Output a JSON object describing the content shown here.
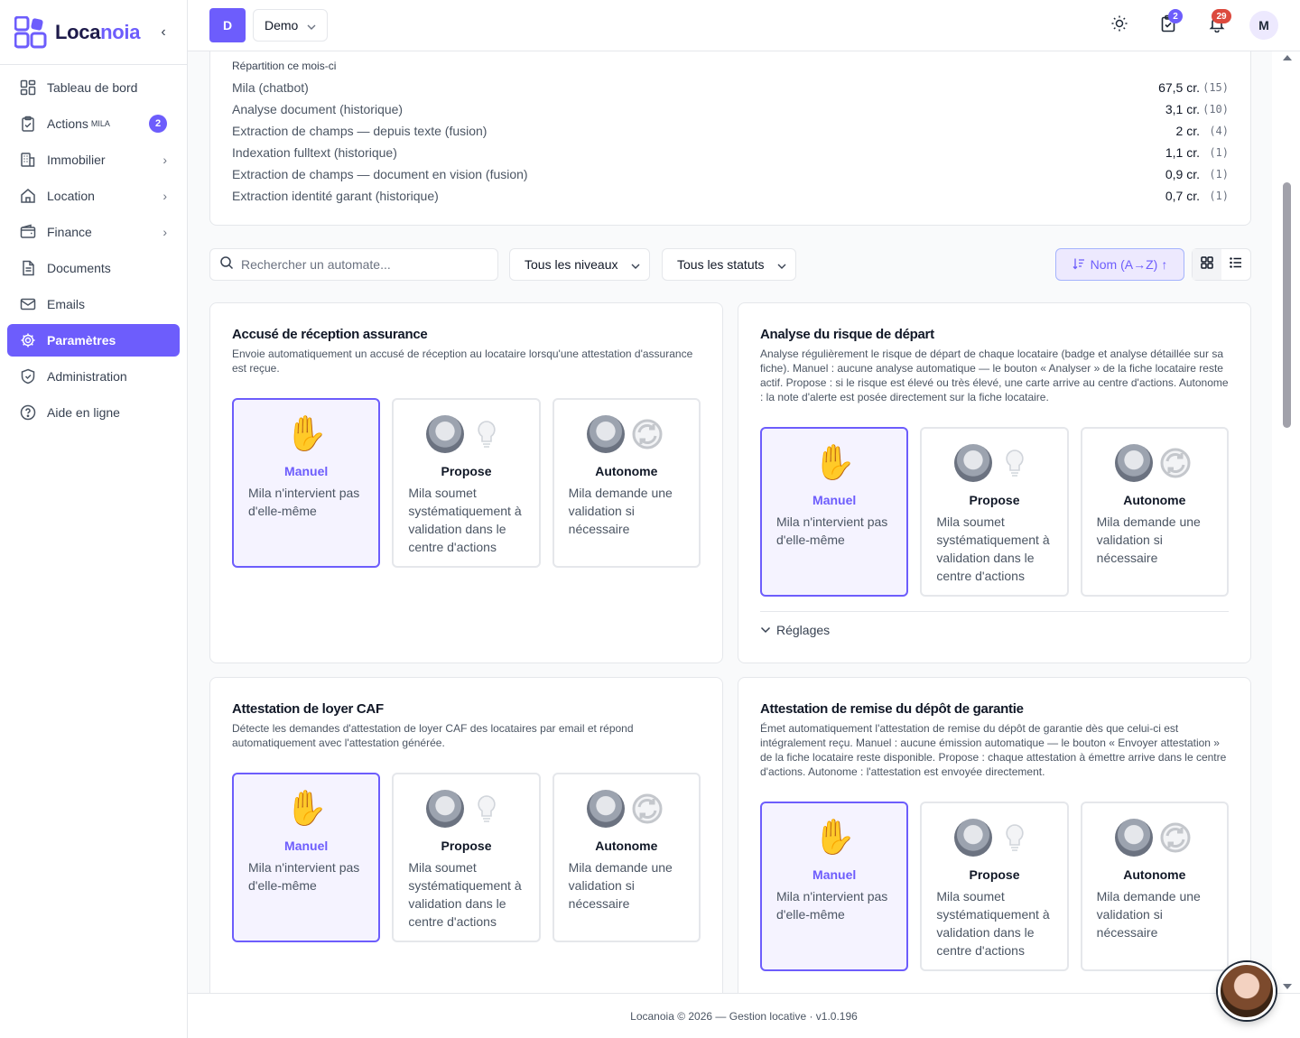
{
  "brand": {
    "name_prefix": "Loca",
    "name_suffix": "noia"
  },
  "sidebar": {
    "items": [
      {
        "label": "Tableau de bord",
        "icon": "dashboard-icon"
      },
      {
        "label": "Actions",
        "sup": "MILA",
        "badge": "2",
        "icon": "clipboard-check-icon"
      },
      {
        "label": "Immobilier",
        "icon": "building-icon"
      },
      {
        "label": "Location",
        "icon": "home-icon"
      },
      {
        "label": "Finance",
        "icon": "wallet-icon"
      },
      {
        "label": "Documents",
        "icon": "document-icon"
      },
      {
        "label": "Emails",
        "icon": "mail-icon"
      },
      {
        "label": "Paramètres",
        "icon": "gear-icon",
        "active": true
      },
      {
        "label": "Administration",
        "icon": "shield-icon"
      },
      {
        "label": "Aide en ligne",
        "icon": "help-icon"
      }
    ]
  },
  "topbar": {
    "org_initial": "D",
    "org_name": "Demo",
    "tasks_badge": "2",
    "notifications_badge": "29",
    "user_initial": "M"
  },
  "usage": {
    "title": "Répartition ce mois-ci",
    "rows": [
      {
        "label": "Mila (chatbot)",
        "value": "67,5 cr.",
        "count": "(15)"
      },
      {
        "label": "Analyse document (historique)",
        "value": "3,1 cr.",
        "count": "(10)"
      },
      {
        "label": "Extraction de champs — depuis texte (fusion)",
        "value": "2 cr.",
        "count": "(4)"
      },
      {
        "label": "Indexation fulltext (historique)",
        "value": "1,1 cr.",
        "count": "(1)"
      },
      {
        "label": "Extraction de champs — document en vision (fusion)",
        "value": "0,9 cr.",
        "count": "(1)"
      },
      {
        "label": "Extraction identité garant (historique)",
        "value": "0,7 cr.",
        "count": "(1)"
      }
    ]
  },
  "filters": {
    "search_placeholder": "Rechercher un automate...",
    "level": "Tous les niveaux",
    "status": "Tous les statuts",
    "sort": "Nom (A→Z)"
  },
  "options": {
    "manual_label": "Manuel",
    "manual_desc": "Mila n'intervient pas d'elle-même",
    "propose_label": "Propose",
    "propose_desc": "Mila soumet systématiquement à validation dans le centre d'actions",
    "auto_label": "Autonome",
    "auto_desc": "Mila demande une validation si nécessaire"
  },
  "automates": [
    {
      "title": "Accusé de réception assurance",
      "description": "Envoie automatiquement un accusé de réception au locataire lorsqu'une attestation d'assurance est reçue.",
      "selected": "Manuel"
    },
    {
      "title": "Analyse du risque de départ",
      "description": "Analyse régulièrement le risque de départ de chaque locataire (badge et analyse détaillée sur sa fiche). Manuel : aucune analyse automatique — le bouton « Analyser » de la fiche locataire reste actif. Propose : si le risque est élevé ou très élevé, une carte arrive au centre d'actions. Autonome : la note d'alerte est posée directement sur la fiche locataire.",
      "selected": "Manuel",
      "settings_label": "Réglages"
    },
    {
      "title": "Attestation de loyer CAF",
      "description": "Détecte les demandes d'attestation de loyer CAF des locataires par email et répond automatiquement avec l'attestation générée.",
      "selected": "Manuel"
    },
    {
      "title": "Attestation de remise du dépôt de garantie",
      "description": "Émet automatiquement l'attestation de remise du dépôt de garantie dès que celui-ci est intégralement reçu. Manuel : aucune émission automatique — le bouton « Envoyer attestation » de la fiche locataire reste disponible. Propose : chaque attestation à émettre arrive dans le centre d'actions. Autonome : l'attestation est envoyée directement.",
      "selected": "Manuel"
    }
  ],
  "footer": {
    "text": "Locanoia © 2026 — Gestion locative · v1.0.196"
  },
  "colors": {
    "accent": "#6d5dfc",
    "badge_red": "#dc4a3e"
  }
}
